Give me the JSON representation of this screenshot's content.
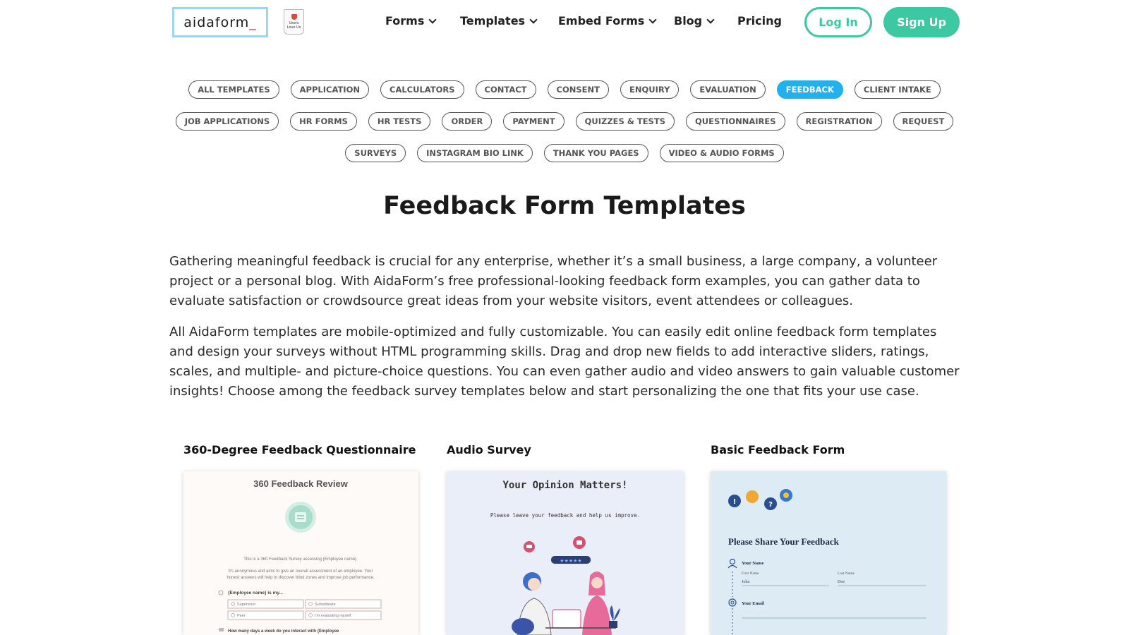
{
  "header": {
    "logo_text": "aidaform",
    "logo_underscore": "_",
    "badge_lines": [
      "Users",
      "Love Us"
    ],
    "nav": [
      {
        "label": "Forms",
        "dropdown": true
      },
      {
        "label": "Templates",
        "dropdown": true
      },
      {
        "label": "Embed Forms",
        "dropdown": true
      },
      {
        "label": "Blog",
        "dropdown": true
      },
      {
        "label": "Pricing",
        "dropdown": false
      }
    ],
    "login_label": "Log In",
    "signup_label": "Sign Up"
  },
  "categories": {
    "row1": [
      "ALL TEMPLATES",
      "APPLICATION",
      "CALCULATORS",
      "CONTACT",
      "CONSENT",
      "ENQUIRY",
      "EVALUATION",
      "FEEDBACK",
      "CLIENT INTAKE"
    ],
    "row2": [
      "JOB APPLICATIONS",
      "HR FORMS",
      "HR TESTS",
      "ORDER",
      "PAYMENT",
      "QUIZZES & TESTS",
      "QUESTIONNAIRES",
      "REGISTRATION",
      "REQUEST"
    ],
    "row3": [
      "SURVEYS",
      "INSTAGRAM BIO LINK",
      "THANK YOU PAGES",
      "VIDEO & AUDIO FORMS"
    ],
    "active": "FEEDBACK"
  },
  "main": {
    "title": "Feedback Form Templates",
    "paragraph1": "Gathering meaningful feedback is crucial for any enterprise, whether it’s a small business, a large company, a volunteer project or a personal blog. With AidaForm’s free professional-looking feedback form examples, you can gather data to evaluate satisfaction or crowdsource great ideas from your website visitors, event attendees or colleagues.",
    "paragraph2": "All AidaForm templates are mobile-optimized and fully customizable. You can easily edit online feedback form templates and design your surveys without HTML programming skills. Drag and drop new fields to add interactive sliders, ratings, scales, and multiple- and picture-choice questions. You can even gather audio and video answers to gain valuable customer insights! Choose among the feedback survey templates below and start personalizing the one that fits your use case."
  },
  "templates": [
    {
      "title": "360-Degree Feedback Questionnaire",
      "preview_heading": "360 Feedback Review",
      "preview_intro": "This is a 360 Feedback Survey assessing {Employee name}.",
      "preview_body_1": "It's anonymous and aims to give an overall assessment of an employee. Your",
      "preview_body_2": "honest answers will help to discover blind zones and improve job performance.",
      "preview_question": "{Employee name} is my...",
      "preview_options": [
        "Supervisor",
        "Subordinate",
        "Peer",
        "I'm evaluating myself"
      ],
      "preview_question2": "How many days a week do you interact with {Employee",
      "bg_color": "#fdfaf8",
      "accent_color": "#a8dccb"
    },
    {
      "title": "Audio Survey",
      "preview_heading": "Your Opinion Matters!",
      "preview_sub": "Please leave your feedback and help us improve.",
      "bg_color": "#e9eef9",
      "accent_color": "#3a55a8"
    },
    {
      "title": "Basic Feedback Form",
      "preview_heading": "Please Share Your Feedback",
      "preview_name_label": "Your Name",
      "preview_first_label": "First Name",
      "preview_first_value": "John",
      "preview_last_label": "Last Name",
      "preview_last_value": "Doe",
      "preview_email_label": "Your Email",
      "bg_color": "#dcebf4",
      "accent_color": "#2a4f8e"
    }
  ]
}
